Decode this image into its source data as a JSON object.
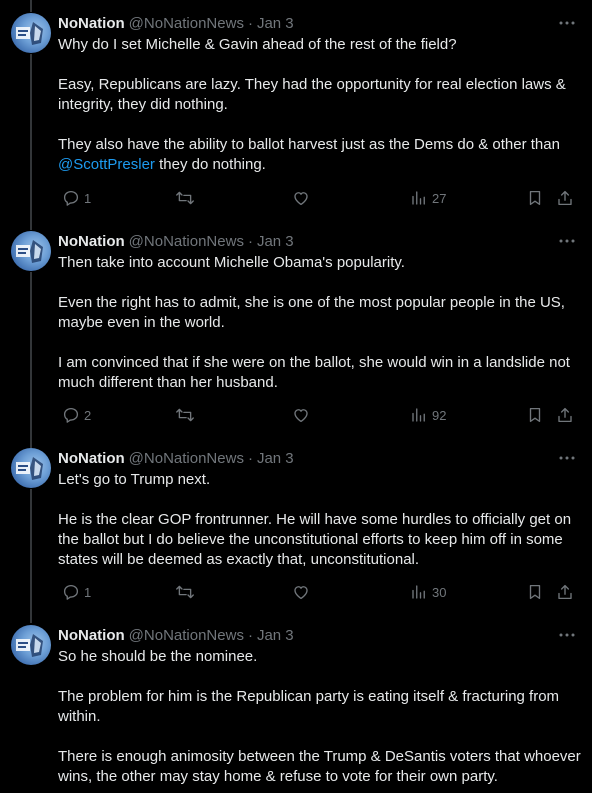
{
  "tweets": [
    {
      "name": "NoNation",
      "handle": "@NoNationNews",
      "separator": "·",
      "date": "Jan 3",
      "paragraphs": [
        "Why do I set Michelle & Gavin ahead of the rest of the field?",
        "Easy, Republicans are lazy.  They had the opportunity for real election laws & integrity, they did nothing."
      ],
      "para3_before": "They also have the ability to ballot harvest just as the Dems do & other than ",
      "para3_mention": "@ScottPresler",
      "para3_after": " they do nothing.",
      "replies": "1",
      "retweets": "",
      "likes": "",
      "views": "27"
    },
    {
      "name": "NoNation",
      "handle": "@NoNationNews",
      "separator": "·",
      "date": "Jan 3",
      "paragraphs": [
        "Then take into account Michelle Obama's popularity.",
        "Even the right has to admit, she is one of the most popular people in the US, maybe even in the world.",
        "I am convinced that if she were on the ballot, she would win in a landslide not much different than her husband."
      ],
      "replies": "2",
      "retweets": "",
      "likes": "",
      "views": "92"
    },
    {
      "name": "NoNation",
      "handle": "@NoNationNews",
      "separator": "·",
      "date": "Jan 3",
      "paragraphs": [
        "Let's go to Trump next.",
        "He is the clear GOP frontrunner. He will have some hurdles to officially get on the ballot but I do believe the unconstitutional efforts to keep him off in some states will be deemed as exactly that, unconstitutional."
      ],
      "replies": "1",
      "retweets": "",
      "likes": "",
      "views": "30"
    },
    {
      "name": "NoNation",
      "handle": "@NoNationNews",
      "separator": "·",
      "date": "Jan 3",
      "paragraphs": [
        "So he should be the nominee.",
        "The problem for him is the Republican party is eating itself & fracturing from within.",
        "There is enough animosity between the Trump & DeSantis voters that whoever wins, the other may stay home & refuse to vote for their own party."
      ]
    }
  ],
  "colors": {
    "background": "#000000",
    "text": "#e7e9ea",
    "secondary": "#71767b",
    "link": "#1d9bf0",
    "thread_line": "#333639"
  },
  "icons": [
    "more-icon",
    "reply-icon",
    "retweet-icon",
    "like-icon",
    "views-icon",
    "bookmark-icon",
    "share-icon"
  ]
}
